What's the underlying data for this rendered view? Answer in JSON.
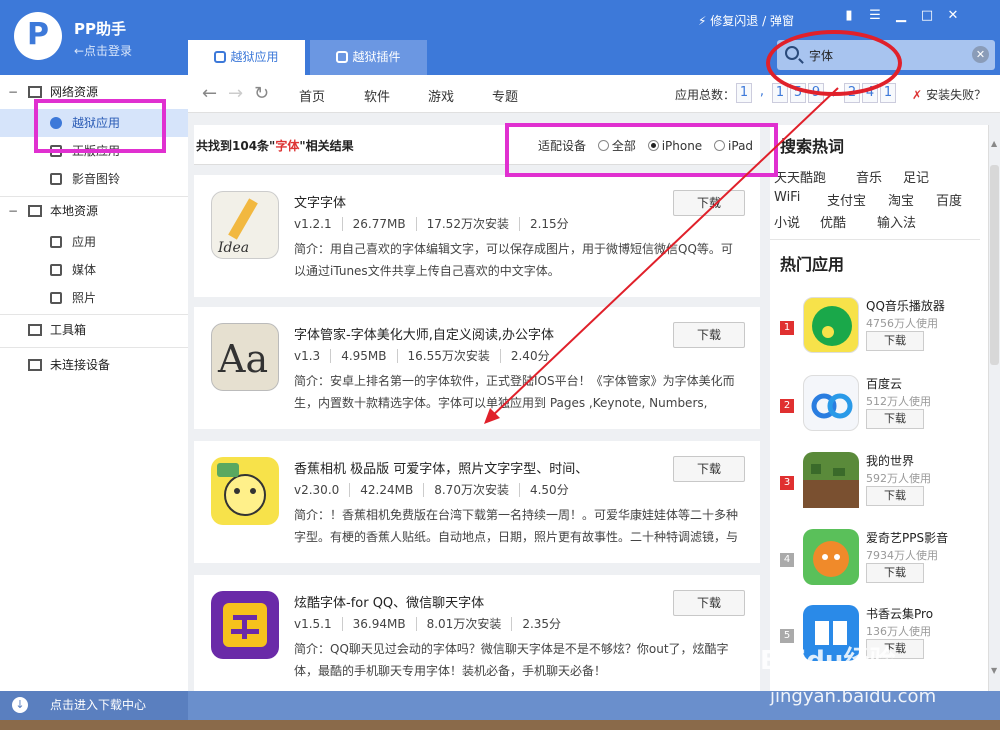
{
  "app": {
    "name": "PP助手",
    "login_hint": "←点击登录",
    "logo_letter": "P"
  },
  "tabs": [
    {
      "label": "越狱应用"
    },
    {
      "label": "越狱插件"
    }
  ],
  "titlebar": {
    "repair_label": "修复闪退 / 弹窗"
  },
  "search": {
    "value": "字体"
  },
  "sidebar": {
    "sections": [
      {
        "label": "网络资源",
        "toggle": "−",
        "items": [
          {
            "label": "越狱应用",
            "active": true
          },
          {
            "label": "正版应用"
          },
          {
            "label": "影音图铃"
          }
        ]
      },
      {
        "label": "本地资源",
        "toggle": "−",
        "items": [
          {
            "label": "应用"
          },
          {
            "label": "媒体"
          },
          {
            "label": "照片"
          }
        ]
      },
      {
        "label": "工具箱"
      },
      {
        "label": "未连接设备"
      }
    ],
    "download_center": "点击进入下载中心"
  },
  "nav": {
    "links": [
      "首页",
      "软件",
      "游戏",
      "专题"
    ],
    "count_label": "应用总数：",
    "count_digits": [
      "1",
      ",",
      "1",
      "5",
      "9",
      ",",
      "2",
      "4",
      "1"
    ],
    "fail_label": "安装失败？"
  },
  "results": {
    "summary_prefix": "共找到104条\"",
    "keyword": "字体",
    "summary_suffix": "\"相关结果",
    "device_label": "适配设备",
    "device_options": [
      "全部",
      "iPhone",
      "iPad"
    ],
    "device_selected": "iPhone",
    "download_label": "下载",
    "apps": [
      {
        "title": "文字字体",
        "version": "v1.2.1",
        "size": "26.77MB",
        "installs": "17.52万次安装",
        "score": "2.15分",
        "desc": "简介：用自己喜欢的字体编辑文字，可以保存成图片，用于微博短信微信QQ等。可以通过iTunes文件共享上传自己喜欢的中文字体。"
      },
      {
        "title": "字体管家-字体美化大师,自定义阅读,办公字体",
        "version": "v1.3",
        "size": "4.95MB",
        "installs": "16.55万次安装",
        "score": "2.40分",
        "desc": "简介：安卓上排名第一的字体软件，正式登陆IOS平台！《字体管家》为字体美化而生，内置数十款精选字体。字体可以单独应用到 Pages ,Keynote, Numbers, Office"
      },
      {
        "title": "香蕉相机 极品版 可爱字体，照片文字字型、时间、",
        "version": "v2.30.0",
        "size": "42.24MB",
        "installs": "8.70万次安装",
        "score": "4.50分",
        "desc": "简介：！香蕉相机免费版在台湾下载第一名持续一周！。可爱华康娃娃体等二十多种字型。有梗的香蕉人贴纸。自动地点，日期，照片更有故事性。二十种特调滤镜，与"
      },
      {
        "title": "炫酷字体-for QQ、微信聊天字体",
        "version": "v1.5.1",
        "size": "36.94MB",
        "installs": "8.01万次安装",
        "score": "2.35分",
        "desc": "简介：QQ聊天见过会动的字体吗？微信聊天字体是不是不够炫？你out了，炫酷字体，最酷的手机聊天专用字体！装机必备，手机聊天必备！"
      }
    ]
  },
  "right": {
    "hot_search_title": "搜索热词",
    "hot_words": [
      "天天酷跑",
      "音乐",
      "足记",
      "WiFi",
      "支付宝",
      "淘宝",
      "百度",
      "小说",
      "优酷",
      "输入法"
    ],
    "hot_apps_title": "热门应用",
    "hot_apps": [
      {
        "rank": "1",
        "name": "QQ音乐播放器",
        "users": "4756万人使用"
      },
      {
        "rank": "2",
        "name": "百度云",
        "users": "512万人使用"
      },
      {
        "rank": "3",
        "name": "我的世界",
        "users": "592万人使用"
      },
      {
        "rank": "4",
        "name": "爱奇艺PPS影音",
        "users": "7934万人使用"
      },
      {
        "rank": "5",
        "name": "书香云集Pro",
        "users": "136万人使用"
      }
    ]
  },
  "watermark": {
    "brand": "Baidu经验",
    "url": "jingyan.baidu.com"
  },
  "colors": {
    "accent": "#3d79d9",
    "highlight": "#e030d0",
    "annotation": "#e0202a"
  }
}
